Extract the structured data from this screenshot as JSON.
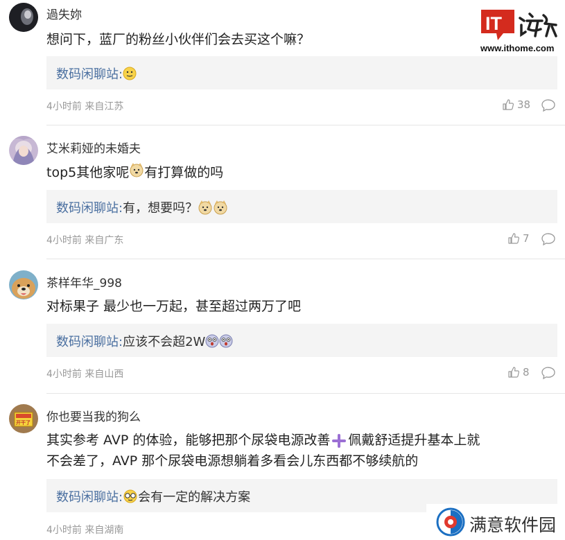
{
  "watermark_top": {
    "brand": "IT之家",
    "url": "www.ithome.com"
  },
  "watermark_bottom": {
    "text": "满意软件园"
  },
  "comments": [
    {
      "username": "過失妳",
      "content": "想问下，蓝厂的粉丝小伙伴们会去买这个嘛？",
      "reply": {
        "user": "数码闲聊站:",
        "text": ""
      },
      "meta": "4小时前 来自江苏",
      "likes": "38"
    },
    {
      "username": "艾米莉娅的未婚夫",
      "content_a": "top5其他家呢",
      "content_b": "有打算做的吗",
      "reply": {
        "user": "数码闲聊站:",
        "text": "有，想要吗？"
      },
      "meta": "4小时前 来自广东",
      "likes": "7"
    },
    {
      "username": "茶样年华_998",
      "content": "对标果子 最少也一万起，甚至超过两万了吧",
      "reply": {
        "user": "数码闲聊站:",
        "text": "应该不会超2W"
      },
      "meta": "4小时前 来自山西",
      "likes": "8"
    },
    {
      "username": "你也要当我的狗么",
      "content_a": "其实参考 AVP 的体验，能够把那个尿袋电源改善",
      "content_b": "佩戴舒适提升基本上就",
      "content_line2": "不会差了，AVP 那个尿袋电源想躺着多看会儿东西都不够续航的",
      "reply": {
        "user": "数码闲聊站:",
        "text": "会有一定的解决方案"
      },
      "meta": "4小时前 来自湖南",
      "avatar_sign": "开干了"
    }
  ],
  "colors": {
    "reply_user": "#4a6fa0",
    "reply_bg": "#f4f4f4",
    "meta": "#999999",
    "ith_red": "#d42b1e"
  },
  "icons": [
    "thumbs-up-icon",
    "comment-bubble-icon",
    "smile-emoji",
    "doge-emoji",
    "shocked-emoji",
    "glasses-emoji",
    "plus-emoji"
  ]
}
